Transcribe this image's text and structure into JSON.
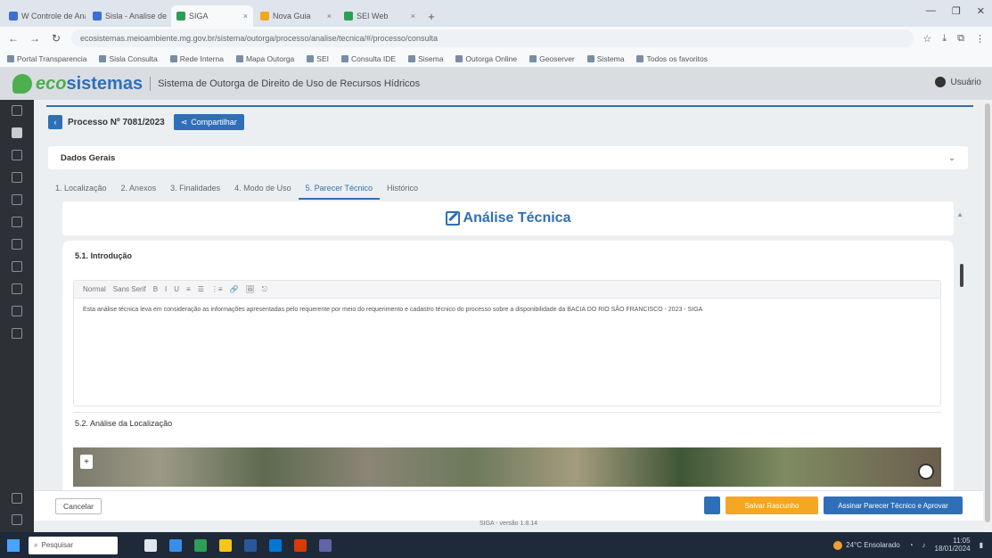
{
  "browser": {
    "tabs": [
      {
        "label": "W Controle de Analises",
        "active": false
      },
      {
        "label": "Sisla - Analise de Pr...",
        "active": false
      },
      {
        "label": "SIGA",
        "active": true
      },
      {
        "label": "Nova Guia",
        "active": false
      },
      {
        "label": "SEI Web",
        "active": false
      }
    ],
    "new_tab": "+",
    "url": "ecosistemas.meioambiente.mg.gov.br/sistema/outorga/processo/analise/tecnica/#/processo/consulta",
    "bookmarks": [
      "Portal Transparencia",
      "Sisla Consulta",
      "Rede Interna",
      "Mapa Outorga",
      "SEI",
      "Consulta IDE",
      "Sisema",
      "Outorga Online",
      "Geoserver",
      "Sistema",
      "Todos os favoritos"
    ]
  },
  "app": {
    "logo_eco": "eco",
    "logo_sis": "sistemas",
    "subtitle": "Sistema de Outorga de Direito de Uso de Recursos Hídricos",
    "user": "Usuário"
  },
  "process": {
    "back": "‹",
    "title": "Processo Nº 7081/2023",
    "share_label": "Compartilhar"
  },
  "dados": {
    "label": "Dados Gerais",
    "chevron": "⌄"
  },
  "tabs": [
    {
      "label": "1. Localização",
      "active": false
    },
    {
      "label": "2. Anexos",
      "active": false
    },
    {
      "label": "3. Finalidades",
      "active": false
    },
    {
      "label": "4. Modo de Uso",
      "active": false
    },
    {
      "label": "5. Parecer Técnico",
      "active": true
    },
    {
      "label": "Histórico",
      "active": false
    }
  ],
  "panel_title": "Análise Técnica",
  "section": {
    "intro_title": "5.1. Introdução",
    "toolbar": [
      "Normal",
      "Sans Serif",
      "B",
      "I",
      "U",
      "≡",
      "☰",
      "⋮≡",
      "🔗",
      "🖼",
      "⎋"
    ],
    "text": "Esta análise técnica leva em consideração as informações apresentadas pelo requerente por meio do requerimento e cadastro técnico do processo sobre a disponibilidade da BACIA DO RIO SÃO FRANCISCO - 2023 - SIGA",
    "loc_title": "5.2. Análise da Localização"
  },
  "footer": {
    "cancel": "Cancelar",
    "orange": "Salvar Rascunho",
    "blue": "Assinar Parecer Técnico e Aprovar",
    "version": "SIGA - versão 1.8.14"
  },
  "taskbar": {
    "search": "Pesquisar",
    "weather": "24°C Ensolarado",
    "time": "11:05",
    "date": "18/01/2024"
  }
}
